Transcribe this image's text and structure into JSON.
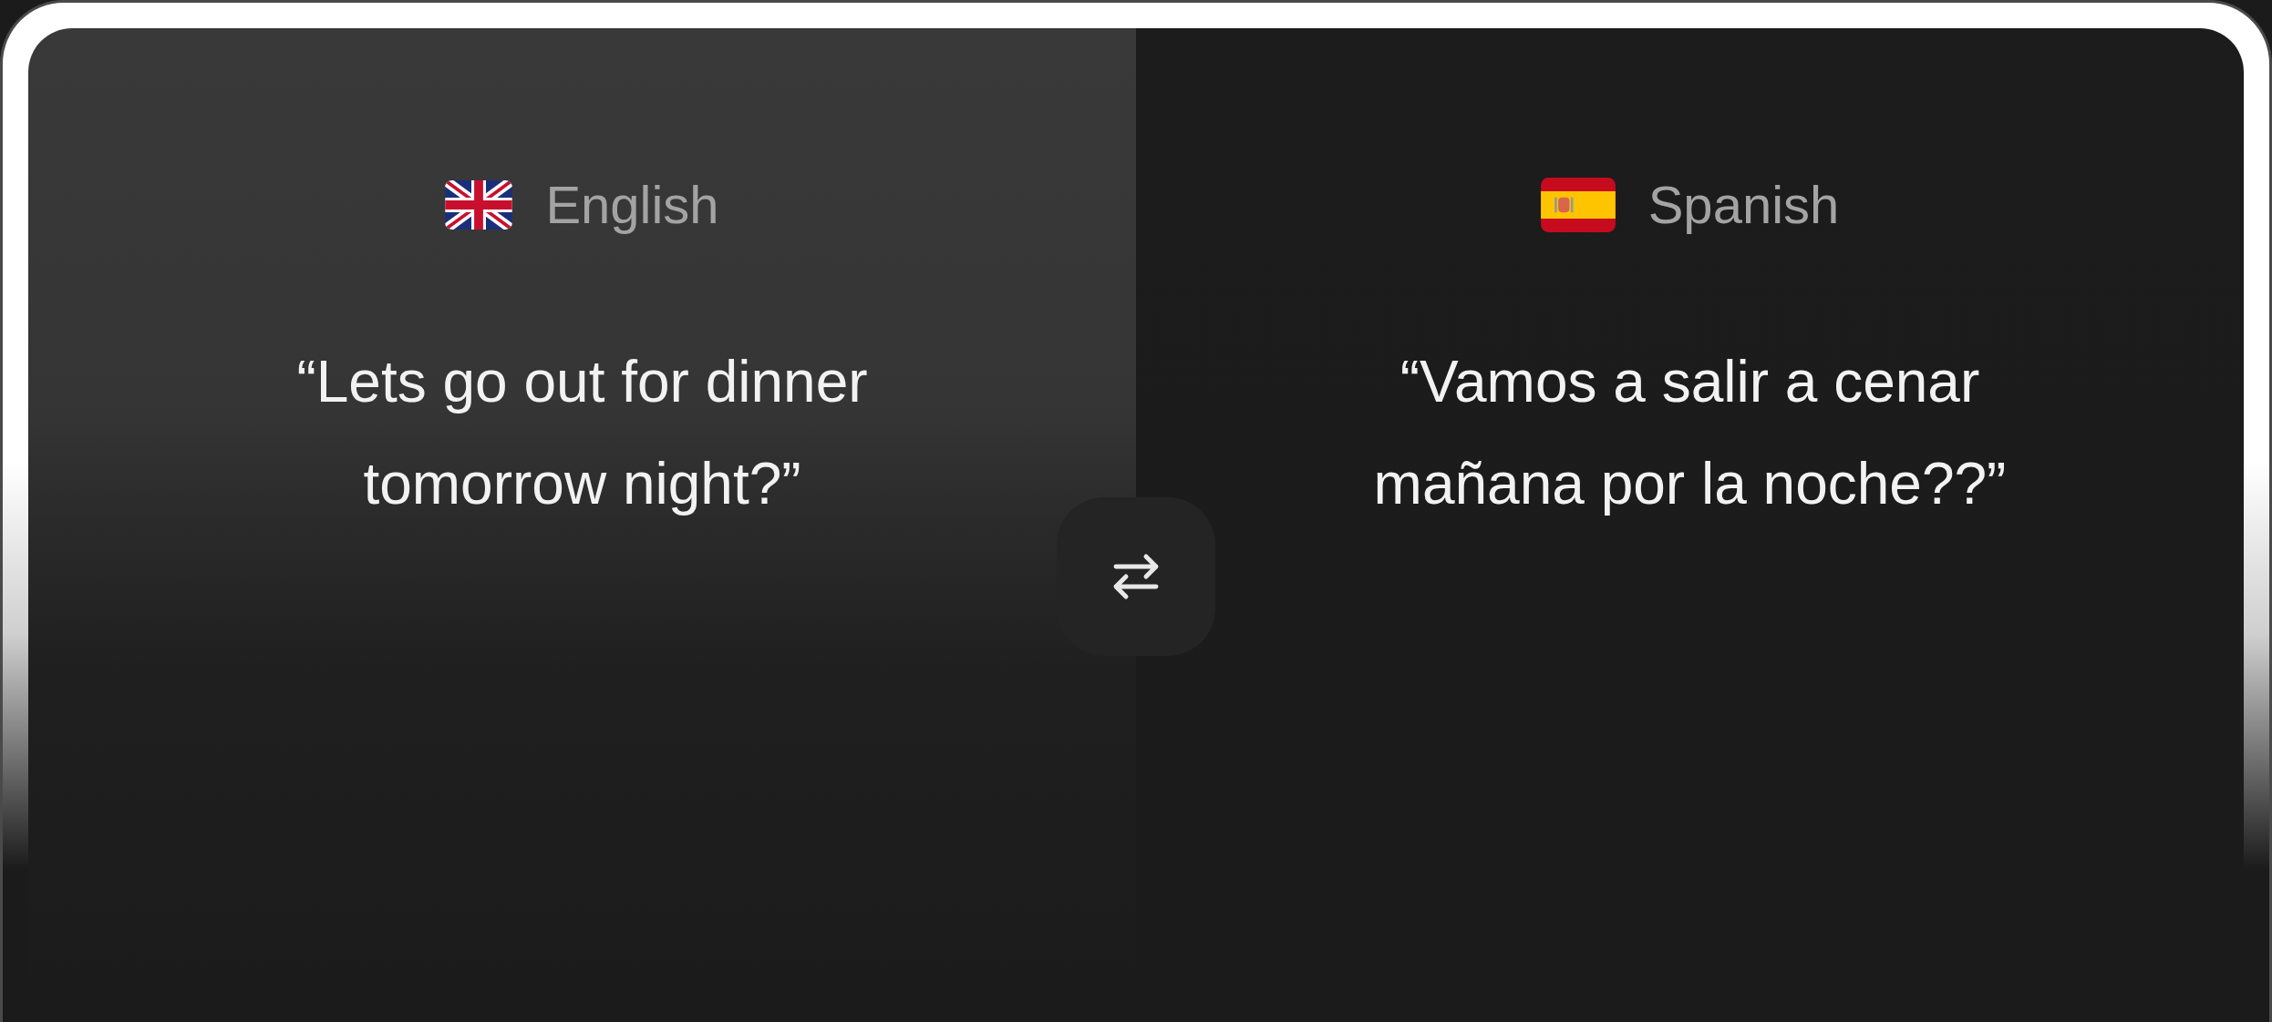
{
  "panels": [
    {
      "language": "English",
      "text_lines": [
        "“Lets go out for dinner",
        "tomorrow night?”"
      ]
    },
    {
      "language": "Spanish",
      "text_lines": [
        "“Vamos a salir a cenar",
        "mañana por la noche??”"
      ]
    }
  ]
}
